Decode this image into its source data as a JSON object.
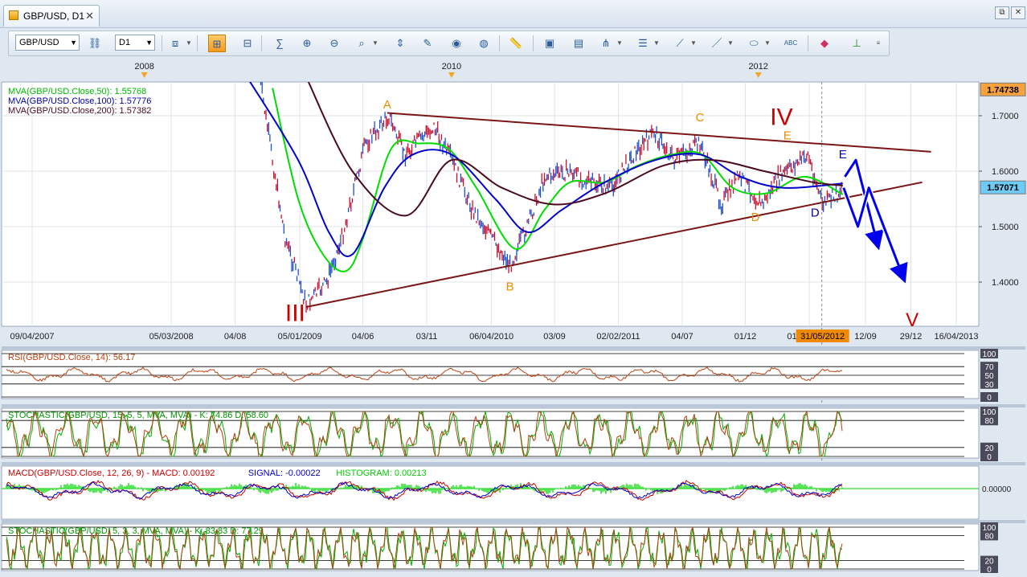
{
  "tab": {
    "title": "GBP/USD, D1",
    "close": "✕"
  },
  "window_buttons": [
    "⧉",
    "✕"
  ],
  "toolbar": {
    "symbol": "GBP/USD",
    "timeframe": "D1",
    "icons": [
      "link-icon",
      "compare-icon",
      "candles-icon",
      "bars-icon",
      "sum-icon",
      "zoom-in-icon",
      "zoom-out-icon",
      "scroll-icon",
      "zoom-fit-icon",
      "anchor-icon",
      "edit-icon",
      "eye-icon",
      "globe-icon",
      "ruler-icon",
      "image-icon",
      "layout-icon",
      "pitchfork-icon",
      "list-icon",
      "fan-icon",
      "pen-icon",
      "ellipse-icon",
      "text-icon",
      "eraser-icon",
      "hierarchy-icon"
    ]
  },
  "chart_data": [
    {
      "type": "line",
      "title": "GBP/USD, D1",
      "legend": [
        {
          "name": "MVA(GBP/USD.Close,50): 1.55768",
          "color": "#00dd00"
        },
        {
          "name": "MVA(GBP/USD.Close,100): 1.57776",
          "color": "#0000cc"
        },
        {
          "name": "MVA(GBP/USD.Close,200): 1.57382",
          "color": "#4b0a1e"
        }
      ],
      "top_year_labels": [
        {
          "label": "2008",
          "x": "2008-01-01"
        },
        {
          "label": "2010",
          "x": "2010-01-01"
        },
        {
          "label": "2012",
          "x": "2012-01-01"
        }
      ],
      "x_tick_labels": [
        {
          "label": "09/04/2007",
          "x": "2007-04-09"
        },
        {
          "label": "05/03/2008",
          "x": "2008-03-05"
        },
        {
          "label": "04/08",
          "x": "2008-08-04"
        },
        {
          "label": "05/01/2009",
          "x": "2009-01-05"
        },
        {
          "label": "04/06",
          "x": "2009-06-04"
        },
        {
          "label": "03/11",
          "x": "2009-11-03"
        },
        {
          "label": "06/04/2010",
          "x": "2010-04-06"
        },
        {
          "label": "03/09",
          "x": "2010-09-03"
        },
        {
          "label": "02/02/2011",
          "x": "2011-02-02"
        },
        {
          "label": "04/07",
          "x": "2011-07-04"
        },
        {
          "label": "01/12",
          "x": "2011-12-01"
        },
        {
          "label": "01/05/2012",
          "x": "2012-05-01"
        },
        {
          "label": "12/09",
          "x": "2012-09-12"
        },
        {
          "label": "29/12",
          "x": "2012-12-29"
        },
        {
          "label": "16/04/2013",
          "x": "2013-04-16"
        }
      ],
      "cursor_label": "31/05/2012",
      "y_ticks": [
        1.4,
        1.5,
        1.6,
        1.7
      ],
      "y_tick_labels": [
        "1.4000",
        "1.5000",
        "1.6000",
        "1.7000"
      ],
      "ylim": [
        1.32,
        1.77
      ],
      "y_markers": [
        {
          "label": "1.74738",
          "value": 1.74738,
          "bg": "#f7a23c"
        },
        {
          "label": "1.57071",
          "value": 1.57071,
          "bg": "#6ecbf5"
        }
      ],
      "price_path": [
        {
          "x": "2008-10-01",
          "y": 1.77
        },
        {
          "x": "2008-11-01",
          "y": 1.62
        },
        {
          "x": "2008-12-01",
          "y": 1.48
        },
        {
          "x": "2009-01-20",
          "y": 1.36
        },
        {
          "x": "2009-03-10",
          "y": 1.4
        },
        {
          "x": "2009-04-15",
          "y": 1.48
        },
        {
          "x": "2009-06-10",
          "y": 1.65
        },
        {
          "x": "2009-08-05",
          "y": 1.7
        },
        {
          "x": "2009-09-10",
          "y": 1.63
        },
        {
          "x": "2009-10-20",
          "y": 1.66
        },
        {
          "x": "2009-11-20",
          "y": 1.68
        },
        {
          "x": "2010-01-01",
          "y": 1.62
        },
        {
          "x": "2010-02-20",
          "y": 1.53
        },
        {
          "x": "2010-03-20",
          "y": 1.5
        },
        {
          "x": "2010-05-20",
          "y": 1.43
        },
        {
          "x": "2010-06-30",
          "y": 1.5
        },
        {
          "x": "2010-08-10",
          "y": 1.59
        },
        {
          "x": "2010-10-10",
          "y": 1.6
        },
        {
          "x": "2010-11-20",
          "y": 1.58
        },
        {
          "x": "2011-01-15",
          "y": 1.57
        },
        {
          "x": "2011-03-10",
          "y": 1.63
        },
        {
          "x": "2011-04-28",
          "y": 1.67
        },
        {
          "x": "2011-06-15",
          "y": 1.62
        },
        {
          "x": "2011-08-15",
          "y": 1.65
        },
        {
          "x": "2011-10-05",
          "y": 1.54
        },
        {
          "x": "2011-11-15",
          "y": 1.59
        },
        {
          "x": "2012-01-10",
          "y": 1.54
        },
        {
          "x": "2012-02-20",
          "y": 1.59
        },
        {
          "x": "2012-04-28",
          "y": 1.63
        },
        {
          "x": "2012-06-01",
          "y": 1.54
        },
        {
          "x": "2012-07-10",
          "y": 1.56
        },
        {
          "x": "2012-07-20",
          "y": 1.575
        }
      ],
      "series": [
        {
          "name": "MVA 50",
          "color": "#00dd00",
          "points": [
            {
              "x": "2008-11-01",
              "y": 1.75
            },
            {
              "x": "2009-01-01",
              "y": 1.55
            },
            {
              "x": "2009-03-01",
              "y": 1.45
            },
            {
              "x": "2009-04-25",
              "y": 1.42
            },
            {
              "x": "2009-06-05",
              "y": 1.48
            },
            {
              "x": "2009-08-10",
              "y": 1.64
            },
            {
              "x": "2009-10-15",
              "y": 1.65
            },
            {
              "x": "2009-12-25",
              "y": 1.64
            },
            {
              "x": "2010-03-01",
              "y": 1.57
            },
            {
              "x": "2010-06-01",
              "y": 1.46
            },
            {
              "x": "2010-08-10",
              "y": 1.53
            },
            {
              "x": "2010-10-10",
              "y": 1.58
            },
            {
              "x": "2011-01-01",
              "y": 1.58
            },
            {
              "x": "2011-03-20",
              "y": 1.61
            },
            {
              "x": "2011-06-10",
              "y": 1.63
            },
            {
              "x": "2011-08-20",
              "y": 1.63
            },
            {
              "x": "2011-11-01",
              "y": 1.57
            },
            {
              "x": "2012-01-20",
              "y": 1.56
            },
            {
              "x": "2012-04-20",
              "y": 1.59
            },
            {
              "x": "2012-07-20",
              "y": 1.558
            }
          ]
        },
        {
          "name": "MVA 100",
          "color": "#0000cc",
          "points": [
            {
              "x": "2008-09-01",
              "y": 1.77
            },
            {
              "x": "2009-01-01",
              "y": 1.62
            },
            {
              "x": "2009-03-15",
              "y": 1.49
            },
            {
              "x": "2009-05-10",
              "y": 1.45
            },
            {
              "x": "2009-07-25",
              "y": 1.57
            },
            {
              "x": "2009-10-01",
              "y": 1.63
            },
            {
              "x": "2010-01-01",
              "y": 1.63
            },
            {
              "x": "2010-04-15",
              "y": 1.55
            },
            {
              "x": "2010-07-01",
              "y": 1.49
            },
            {
              "x": "2010-09-20",
              "y": 1.53
            },
            {
              "x": "2011-01-01",
              "y": 1.58
            },
            {
              "x": "2011-05-01",
              "y": 1.62
            },
            {
              "x": "2011-08-15",
              "y": 1.63
            },
            {
              "x": "2011-11-20",
              "y": 1.59
            },
            {
              "x": "2012-03-01",
              "y": 1.57
            },
            {
              "x": "2012-07-20",
              "y": 1.578
            }
          ]
        },
        {
          "name": "MVA 200",
          "color": "#4b0a1e",
          "points": [
            {
              "x": "2009-01-20",
              "y": 1.77
            },
            {
              "x": "2009-05-10",
              "y": 1.6
            },
            {
              "x": "2009-09-15",
              "y": 1.52
            },
            {
              "x": "2010-01-01",
              "y": 1.62
            },
            {
              "x": "2010-05-01",
              "y": 1.57
            },
            {
              "x": "2010-09-01",
              "y": 1.54
            },
            {
              "x": "2011-01-01",
              "y": 1.56
            },
            {
              "x": "2011-05-20",
              "y": 1.61
            },
            {
              "x": "2011-09-15",
              "y": 1.62
            },
            {
              "x": "2012-01-15",
              "y": 1.6
            },
            {
              "x": "2012-05-10",
              "y": 1.58
            },
            {
              "x": "2012-07-20",
              "y": 1.574
            }
          ]
        }
      ],
      "trendlines": [
        {
          "name": "upper",
          "color": "#7a1616",
          "from": {
            "x": "2009-08-01",
            "y": 1.705
          },
          "to": {
            "x": "2013-02-15",
            "y": 1.635
          }
        },
        {
          "name": "lower",
          "color": "#7a1616",
          "from": {
            "x": "2009-01-20",
            "y": 1.355
          },
          "to": {
            "x": "2013-01-25",
            "y": 1.58
          }
        }
      ],
      "projection_arrows": [
        {
          "color": "#0000ee",
          "points": [
            {
              "x": "2012-07-25",
              "y": 1.59
            },
            {
              "x": "2012-08-20",
              "y": 1.62
            },
            {
              "x": "2012-10-10",
              "y": 1.47
            }
          ]
        },
        {
          "color": "#0000ee",
          "points": [
            {
              "x": "2012-07-22",
              "y": 1.57
            },
            {
              "x": "2012-08-25",
              "y": 1.5
            },
            {
              "x": "2012-09-20",
              "y": 1.57
            },
            {
              "x": "2012-12-10",
              "y": 1.41
            }
          ]
        }
      ],
      "wave_labels": [
        {
          "text": "A",
          "color": "#f08a00",
          "x": "2009-08-01",
          "y": 1.713,
          "size": 15
        },
        {
          "text": "B",
          "color": "#f08a00",
          "x": "2010-05-20",
          "y": 1.385,
          "size": 15
        },
        {
          "text": "C",
          "color": "#f08a00",
          "x": "2011-08-15",
          "y": 1.69,
          "size": 15
        },
        {
          "text": "D",
          "color": "#f08a00",
          "x": "2011-12-25",
          "y": 1.51,
          "size": 15
        },
        {
          "text": "E",
          "color": "#f08a00",
          "x": "2012-03-10",
          "y": 1.657,
          "size": 15
        },
        {
          "text": "IV",
          "color": "#c80000",
          "x": "2012-02-25",
          "y": 1.683,
          "size": 30
        },
        {
          "text": "E",
          "color": "#0000aa",
          "x": "2012-07-20",
          "y": 1.623,
          "size": 15
        },
        {
          "text": "D",
          "color": "#0000aa",
          "x": "2012-05-15",
          "y": 1.518,
          "size": 15
        },
        {
          "text": "III",
          "color": "#c80000",
          "x": "2008-12-25",
          "y": 1.33,
          "size": 30
        },
        {
          "text": "V",
          "color": "#c80000",
          "x": "2013-01-01",
          "y": 1.32,
          "size": 24
        }
      ]
    },
    {
      "type": "line",
      "title": "RSI(GBP/USD.Close, 14): 56.17",
      "color": "#c04010",
      "ylim": [
        0,
        100
      ],
      "y_ticks": [
        0,
        30,
        50,
        70,
        100
      ],
      "y_tick_labels": [
        "0",
        "30",
        "50",
        "70",
        "100"
      ],
      "levels": [
        30,
        50,
        70
      ]
    },
    {
      "type": "line",
      "title": "STOCHASTIC(GBP/USD, 15, 5, 5, MVA, MVA) -  K: 74.86  D: 58.60",
      "colors": [
        "#00b000",
        "#b04010"
      ],
      "ylim": [
        0,
        100
      ],
      "y_ticks": [
        0,
        20,
        80,
        100
      ],
      "y_tick_labels": [
        "0",
        "20",
        "80",
        "100"
      ],
      "levels": [
        20,
        80
      ]
    },
    {
      "type": "line",
      "title_parts": [
        {
          "text": "MACD(GBP/USD.Close, 12, 26, 9) -  MACD: 0.00192",
          "color": "#cc0000"
        },
        {
          "text": "SIGNAL: -0.00022",
          "color": "#0000cc"
        },
        {
          "text": "HISTOGRAM: 0.00213",
          "color": "#00cc00"
        }
      ],
      "ylim": [
        -0.03,
        0.02
      ],
      "y_ticks": [
        0
      ],
      "y_tick_labels": [
        "0.00000"
      ]
    },
    {
      "type": "line",
      "title": "STOCHASTIC(GBP/USD, 5, 3, 3, MVA, MVA) -  K: 83.83  D: 77.29",
      "colors": [
        "#00b000",
        "#b04010"
      ],
      "ylim": [
        0,
        100
      ],
      "y_ticks": [
        0,
        20,
        80,
        100
      ],
      "y_tick_labels": [
        "0",
        "20",
        "80",
        "100"
      ],
      "levels": [
        20,
        80
      ]
    }
  ]
}
